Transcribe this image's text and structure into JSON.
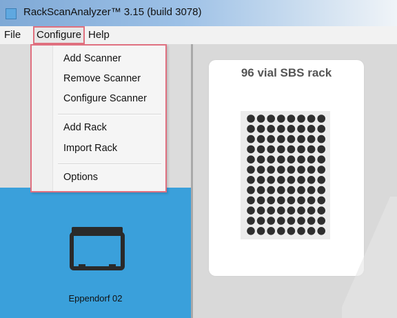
{
  "window": {
    "title": "RackScanAnalyzer™ 3.15 (build 3078)"
  },
  "menubar": {
    "items": [
      "File",
      "Configure",
      "Help"
    ]
  },
  "configure_menu": {
    "items": [
      "Add Scanner",
      "Remove Scanner",
      "Configure Scanner",
      "Add Rack",
      "Import Rack",
      "Options"
    ]
  },
  "scanner": {
    "label": "Eppendorf 02"
  },
  "rack": {
    "title": "96 vial SBS rack",
    "rows": 12,
    "columns": 8
  },
  "colors": {
    "accent": "#3aa0db",
    "highlight": "#e07080"
  }
}
